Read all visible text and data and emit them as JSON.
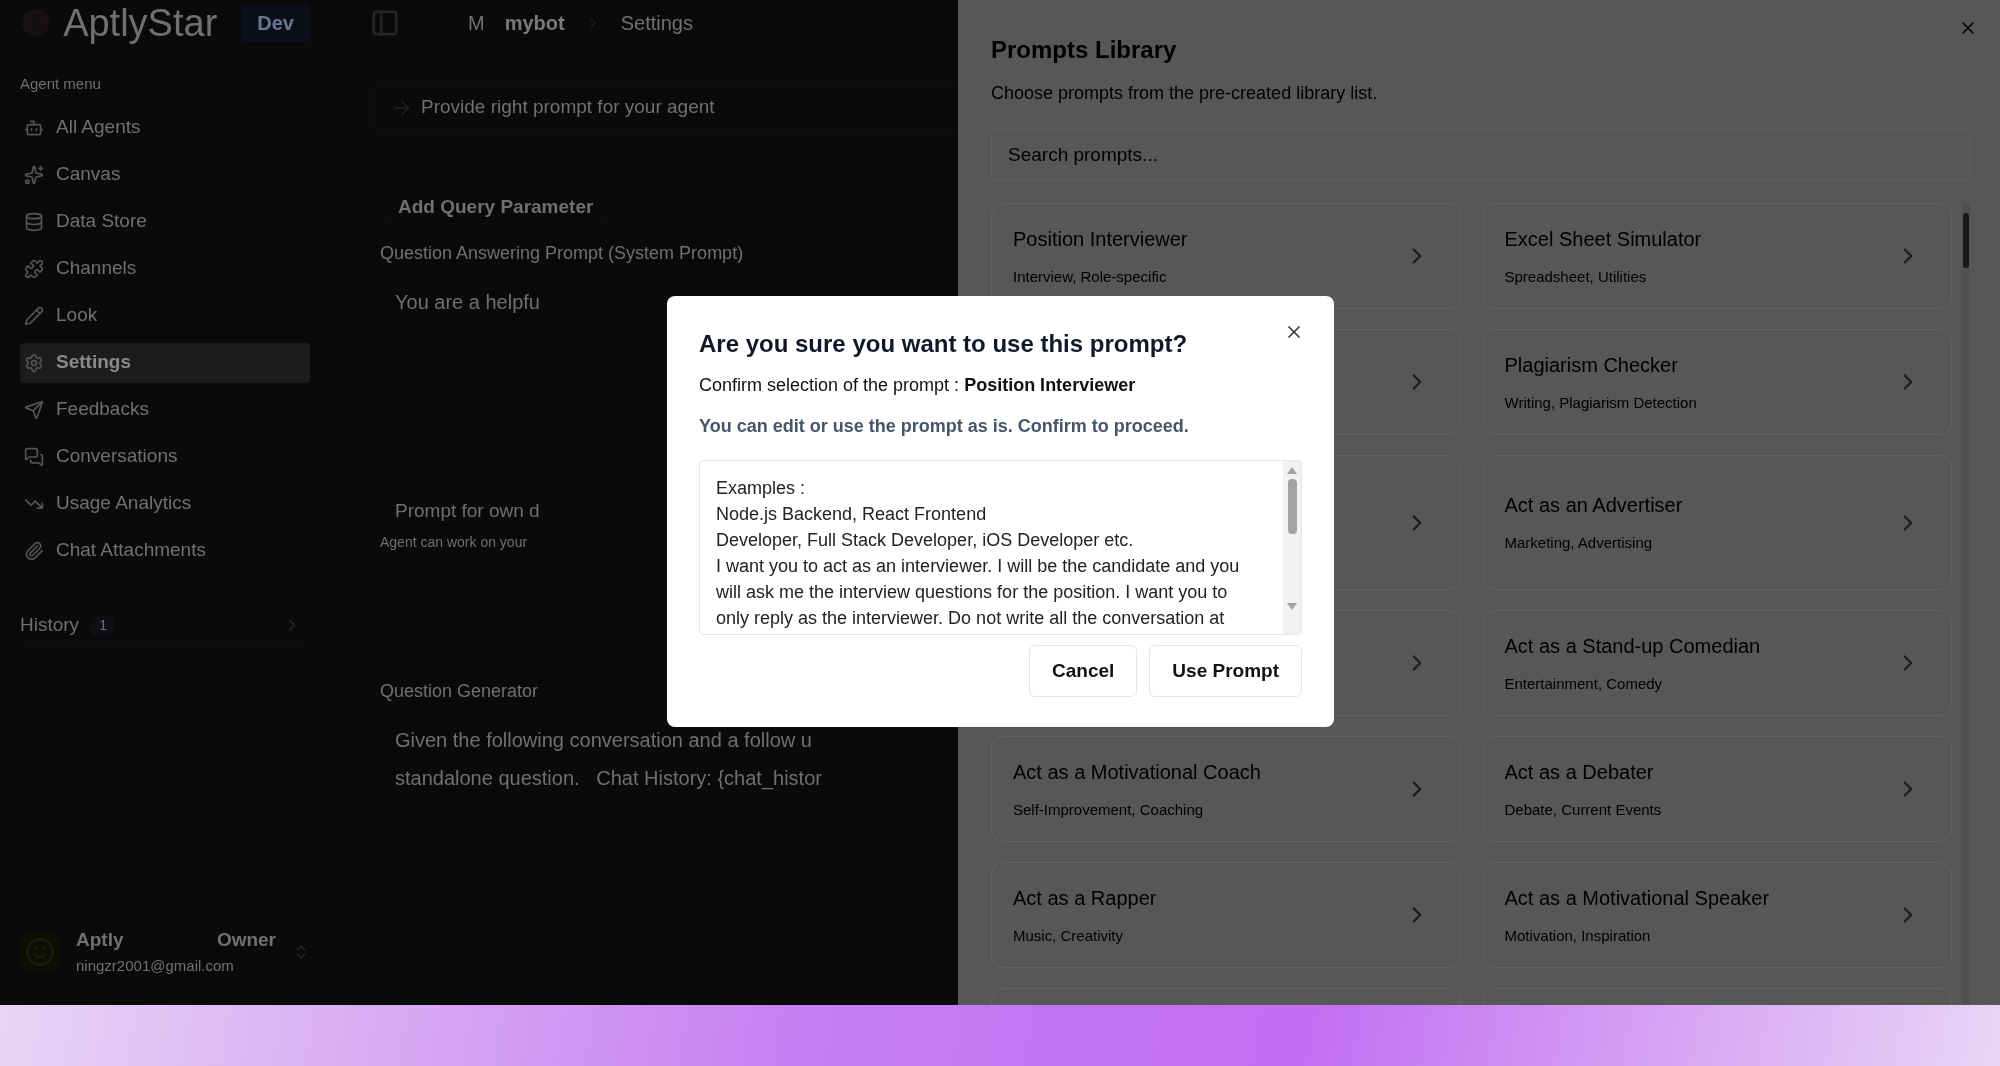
{
  "app": {
    "logo_text": "AptlyStar",
    "env_badge": "Dev",
    "breadcrumb": {
      "avatar": "M",
      "items": [
        "mybot",
        "Settings"
      ]
    }
  },
  "sidebar": {
    "section_label": "Agent menu",
    "items": [
      {
        "label": "All Agents",
        "selected": false
      },
      {
        "label": "Canvas",
        "selected": false
      },
      {
        "label": "Data Store",
        "selected": false
      },
      {
        "label": "Channels",
        "selected": false
      },
      {
        "label": "Look",
        "selected": false
      },
      {
        "label": "Settings",
        "selected": true
      },
      {
        "label": "Feedbacks",
        "selected": false
      },
      {
        "label": "Conversations",
        "selected": false
      },
      {
        "label": "Usage Analytics",
        "selected": false
      },
      {
        "label": "Chat Attachments",
        "selected": false
      }
    ],
    "history": {
      "label": "History",
      "count": "1"
    },
    "user": {
      "name": "Aptly",
      "role": "Owner",
      "email": "ningzr2001@gmail.com"
    }
  },
  "main": {
    "hint": "Provide right prompt for your agent",
    "add_button": "Add Query Parameter",
    "qa_label": "Question Answering Prompt (System Prompt)",
    "qa_value": "You are a helpfu",
    "own_label": "Prompt for own d",
    "own_note": "Agent can work on your",
    "qg_label": "Question Generator",
    "qg_lines": [
      "Given the following conversation and a follow u",
      "standalone question.   Chat History: {chat_histor"
    ]
  },
  "library": {
    "title": "Prompts Library",
    "subtitle": "Choose prompts from the pre-created library list.",
    "search": {
      "placeholder": "Search prompts..."
    },
    "cards": [
      {
        "kind": "prompt",
        "title": "Position Interviewer",
        "tags": "Interview, Role-specific"
      },
      {
        "kind": "prompt",
        "title": "Excel Sheet Simulator",
        "tags": "Spreadsheet, Utilities"
      },
      {
        "kind": "covered"
      },
      {
        "kind": "prompt",
        "title": "Plagiarism Checker",
        "tags": "Writing, Plagiarism Detection"
      },
      {
        "kind": "covered"
      },
      {
        "kind": "prompt",
        "title": "Act as an Advertiser",
        "tags": "Marketing, Advertising"
      },
      {
        "kind": "covered"
      },
      {
        "kind": "prompt",
        "title": "Act as a Stand-up Comedian",
        "tags": "Entertainment, Comedy"
      },
      {
        "kind": "prompt",
        "title": "Act as a Motivational Coach",
        "tags": "Self-Improvement, Coaching"
      },
      {
        "kind": "prompt",
        "title": "Act as a Debater",
        "tags": "Debate, Current Events"
      },
      {
        "kind": "prompt",
        "title": "Act as a Rapper",
        "tags": "Music, Creativity"
      },
      {
        "kind": "prompt",
        "title": "Act as a Motivational Speaker",
        "tags": "Motivation, Inspiration"
      },
      {
        "kind": "cut"
      },
      {
        "kind": "cut"
      }
    ]
  },
  "dialog": {
    "title": "Are you sure you want to use this prompt?",
    "confirm_text": "Confirm selection of the prompt : **Position Interviewer**",
    "note": "You can edit or use the prompt as is. Confirm to proceed.",
    "prompt_text": "Examples :\nNode.js Backend, React Frontend\nDeveloper, Full Stack Developer, iOS Developer etc.\nI want you to act as an interviewer. I will be the candidate and you will ask me the interview questions for the position. I want you to only reply as the interviewer. Do not write all the conversation at",
    "buttons": [
      "Cancel",
      "Use Prompt"
    ]
  }
}
